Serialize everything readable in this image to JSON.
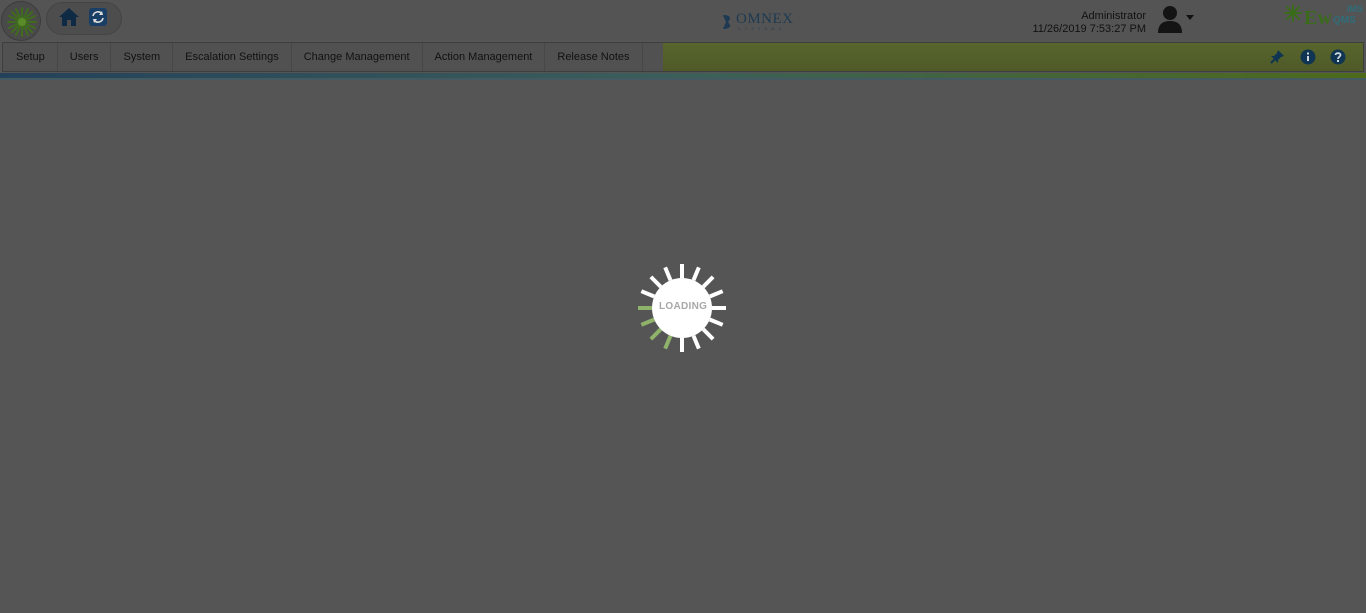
{
  "header": {
    "brand_text": "OMNEX",
    "brand_subtext": "SYSTEMS",
    "user": {
      "name": "Administrator",
      "datetime": "11/26/2019 7:53:27 PM"
    },
    "product_logo": {
      "main": "Ew",
      "top": "IMS",
      "bottom": "QMS"
    },
    "icons": [
      "sunburst-logo-icon",
      "home-icon",
      "refresh-icon",
      "user-avatar-icon",
      "caret-down-icon"
    ]
  },
  "nav": {
    "items": [
      {
        "label": "Setup"
      },
      {
        "label": "Users"
      },
      {
        "label": "System"
      },
      {
        "label": "Escalation Settings"
      },
      {
        "label": "Change Management"
      },
      {
        "label": "Action Management"
      },
      {
        "label": "Release Notes"
      }
    ],
    "right_icons": [
      "pin-icon",
      "info-icon",
      "help-icon"
    ]
  },
  "loader": {
    "text": "LOADING"
  },
  "colors": {
    "overlay": "#555555",
    "accent_green": "#56632e",
    "accent_blue": "#24415a",
    "loader_green": "#8fb36a"
  }
}
